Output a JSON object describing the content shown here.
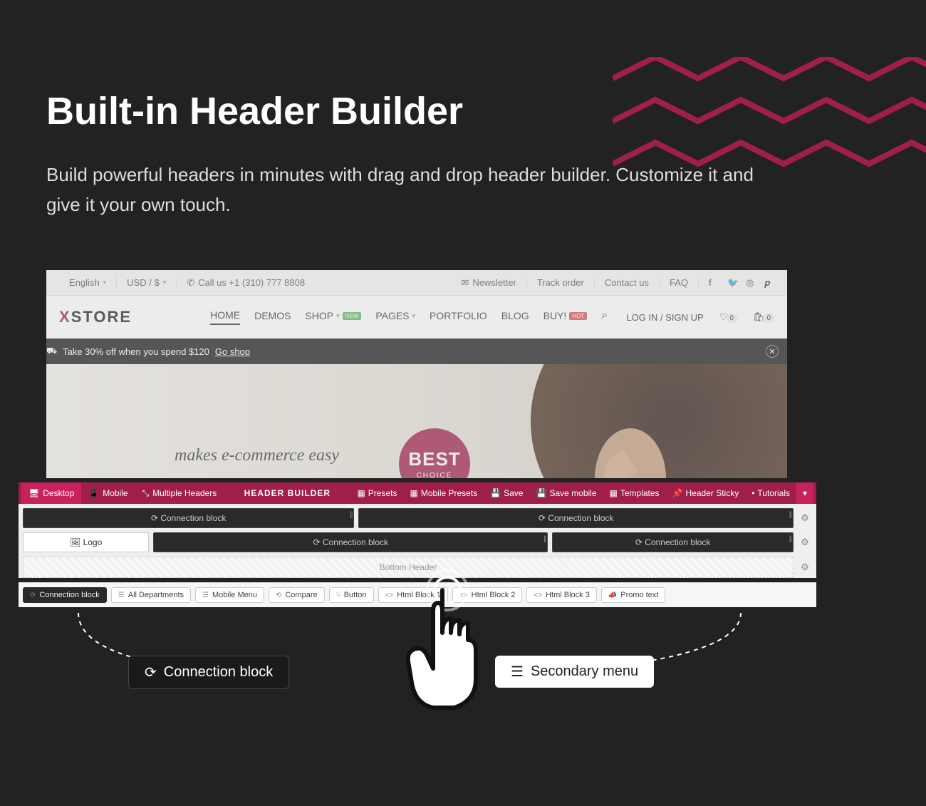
{
  "page": {
    "title": "Built-in Header Builder",
    "subtitle": "Build powerful headers in minutes with drag and drop header builder. Customize it and give it your own touch."
  },
  "topbar": {
    "language": "English",
    "currency": "USD / $",
    "call_label": "Call us +1 (310) 777 8808",
    "newsletter": "Newsletter",
    "track": "Track order",
    "contact": "Contact us",
    "faq": "FAQ"
  },
  "logo": {
    "x": "X",
    "rest": "STORE"
  },
  "nav": {
    "home": "HOME",
    "demos": "DEMOS",
    "shop": "SHOP",
    "shop_badge": "NEW",
    "pages": "PAGES",
    "portfolio": "PORTFOLIO",
    "blog": "BLOG",
    "buy": "BUY!",
    "buy_badge": "HOT"
  },
  "header_right": {
    "login": "LOG IN / SIGN UP",
    "wish_count": "0",
    "cart_count": "0"
  },
  "promo": {
    "text": "Take 30% off when you spend $120",
    "link": "Go shop"
  },
  "hero": {
    "tagline": "makes e-commerce easy",
    "badge_top": "BEST",
    "badge_bottom": "CHOICE"
  },
  "builder": {
    "tabs": {
      "desktop": "Desktop",
      "mobile": "Mobile",
      "multiple": "Multiple Headers"
    },
    "title": "HEADER BUILDER",
    "actions": {
      "presets": "Presets",
      "mobile_presets": "Mobile Presets",
      "save": "Save",
      "save_mobile": "Save mobile",
      "templates": "Templates",
      "sticky": "Header Sticky",
      "tutorials": "Tutorials"
    },
    "blocks": {
      "connection": "Connection block",
      "logo": "Logo",
      "bottom": "Bottom Header"
    },
    "tray": {
      "connection": "Connection block",
      "all_dept": "All Departments",
      "mobile_menu": "Mobile Menu",
      "compare": "Compare",
      "button": "Button",
      "html1": "Html Block 1",
      "html2": "Html Block 2",
      "html3": "Html Block 3",
      "promo": "Promo text"
    }
  },
  "pills": {
    "connection": "Connection block",
    "secondary": "Secondary menu"
  }
}
